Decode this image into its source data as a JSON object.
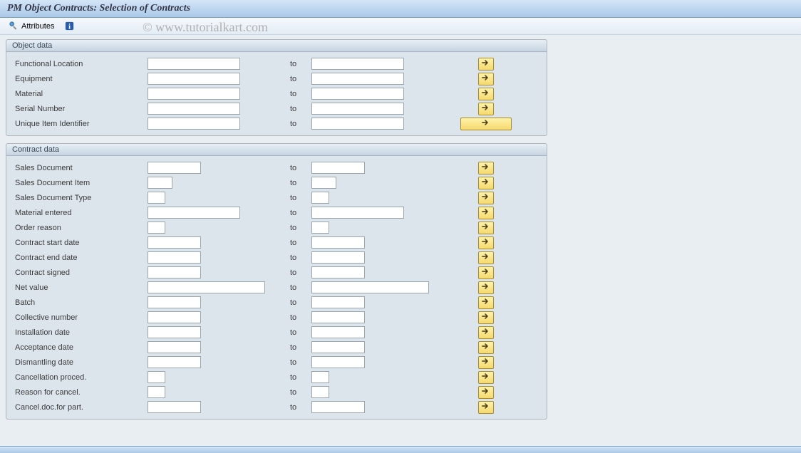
{
  "title": "PM Object Contracts: Selection of Contracts",
  "watermark": "© www.tutorialkart.com",
  "toolbar": {
    "attributes_label": "Attributes"
  },
  "to_label": "to",
  "groups": {
    "object": {
      "header": "Object data",
      "rows": [
        {
          "label": "Functional Location",
          "size": "w130"
        },
        {
          "label": "Equipment",
          "size": "w130"
        },
        {
          "label": "Material",
          "size": "w130"
        },
        {
          "label": "Serial Number",
          "size": "w130"
        },
        {
          "label": "Unique Item Identifier",
          "size": "w130",
          "btn": "wide"
        }
      ]
    },
    "contract": {
      "header": "Contract data",
      "rows": [
        {
          "label": "Sales Document",
          "size": "w85"
        },
        {
          "label": "Sales Document Item",
          "size": "w40"
        },
        {
          "label": "Sales Document Type",
          "size": "w25"
        },
        {
          "label": "Material entered",
          "size": "w130"
        },
        {
          "label": "Order reason",
          "size": "w25"
        },
        {
          "label": "Contract start date",
          "size": "w85"
        },
        {
          "label": "Contract end date",
          "size": "w85"
        },
        {
          "label": "Contract signed",
          "size": "w85"
        },
        {
          "label": "Net value",
          "size": "w170"
        },
        {
          "label": "Batch",
          "size": "w85"
        },
        {
          "label": "Collective number",
          "size": "w85"
        },
        {
          "label": "Installation date",
          "size": "w85"
        },
        {
          "label": "Acceptance date",
          "size": "w85"
        },
        {
          "label": "Dismantling date",
          "size": "w85"
        },
        {
          "label": "Cancellation proced.",
          "size": "w25"
        },
        {
          "label": "Reason for cancel.",
          "size": "w25"
        },
        {
          "label": "Cancel.doc.for part.",
          "size": "w85"
        }
      ]
    }
  }
}
